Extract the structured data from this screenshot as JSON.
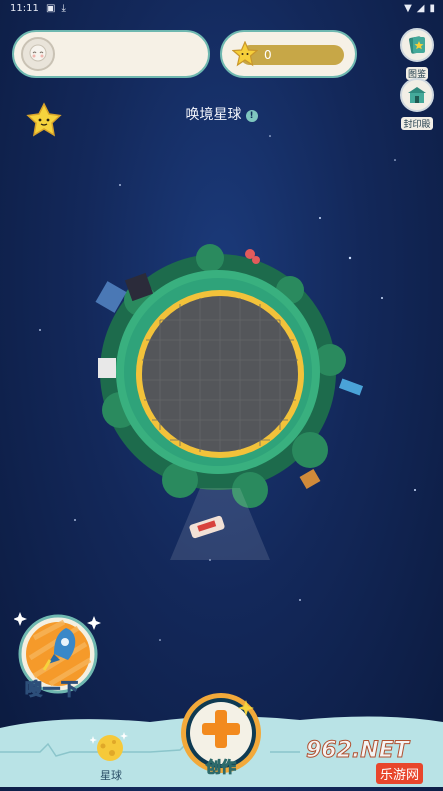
{
  "status_bar": {
    "time": "11:11"
  },
  "header": {
    "star_count": "0",
    "side_buttons": [
      {
        "label": "图鉴",
        "icon": "card-book-icon"
      },
      {
        "label": "封印殿",
        "icon": "temple-icon"
      }
    ]
  },
  "planet": {
    "title": "唤境星球",
    "info_icon": "info-icon"
  },
  "actions": {
    "sniff_label": "嗖一下",
    "create_label": "创作"
  },
  "tabs": [
    {
      "label": "星球",
      "icon": "planet-tab-icon"
    }
  ],
  "watermark": {
    "brand": "962.NET",
    "sub": "乐游网"
  },
  "colors": {
    "background": "#13285a",
    "card_bg": "#f6f1e6",
    "card_border": "#6fb8b0",
    "star_bar": "#c7a747",
    "planet_ring": "#2fa37a",
    "planet_gold": "#f2c23a",
    "accent_orange": "#f28a1e"
  }
}
